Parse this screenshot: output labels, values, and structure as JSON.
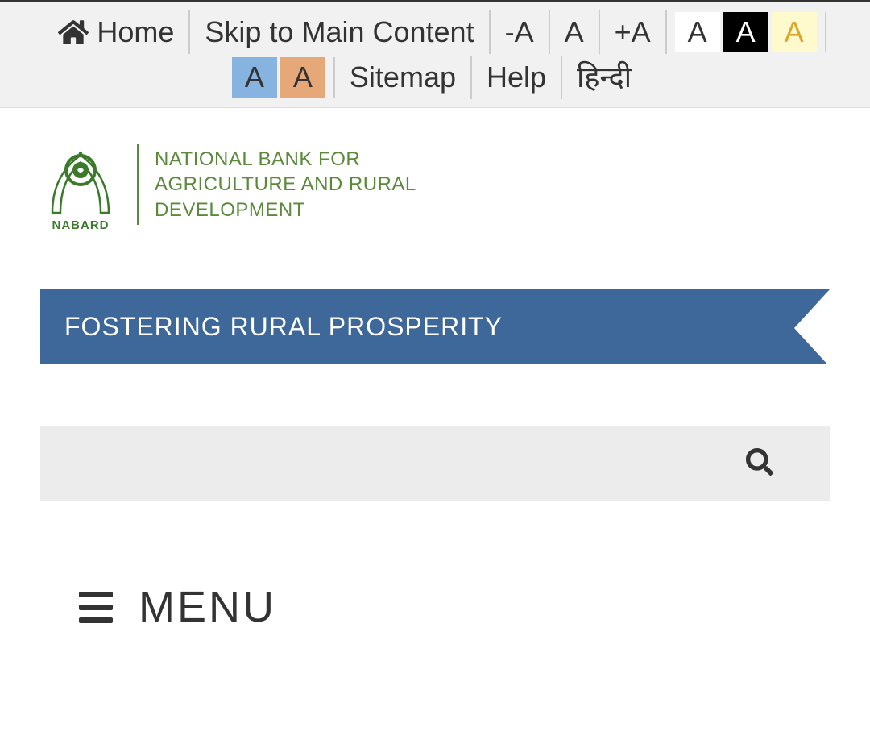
{
  "topbar": {
    "home": "Home",
    "skip": "Skip to Main Content",
    "font_decrease": "-A",
    "font_normal": "A",
    "font_increase": "+A",
    "theme_white": "A",
    "theme_black": "A",
    "theme_yellow": "A",
    "theme_blue": "A",
    "theme_orange": "A",
    "sitemap": "Sitemap",
    "help": "Help",
    "language": "हिन्दी"
  },
  "logo": {
    "name": "NABARD",
    "fullname_line1": "NATIONAL BANK FOR",
    "fullname_line2": "AGRICULTURE AND RURAL",
    "fullname_line3": "DEVELOPMENT"
  },
  "banner": {
    "text": "FOSTERING RURAL PROSPERITY"
  },
  "menu": {
    "label": "MENU"
  }
}
